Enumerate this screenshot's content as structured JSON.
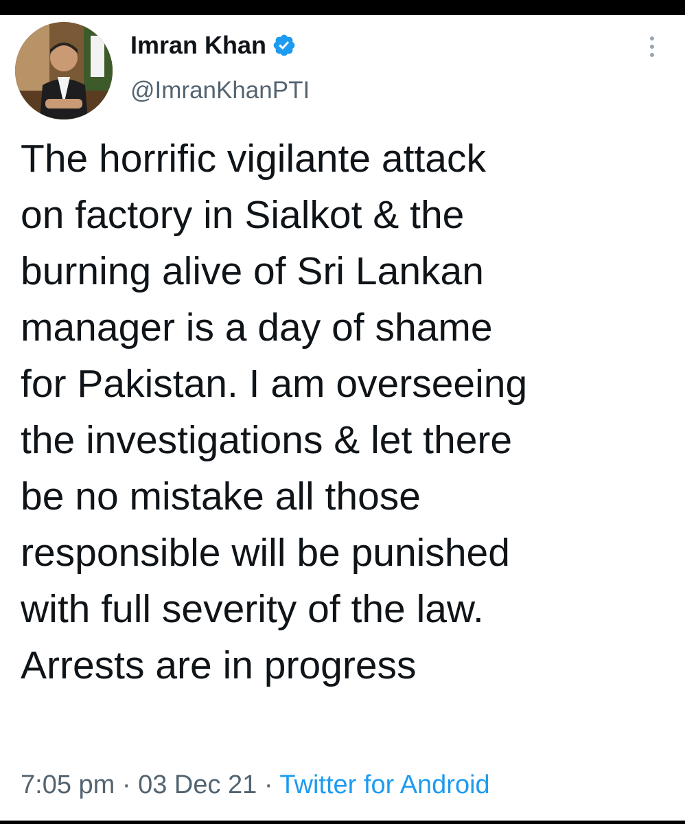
{
  "tweet": {
    "author": {
      "name": "Imran Khan",
      "handle": "@ImranKhanPTI",
      "verified": true,
      "avatar_icon": "profile-photo-icon"
    },
    "text_lines": [
      "The horrific vigilante attack",
      "on factory in Sialkot & the",
      "burning alive of Sri Lankan",
      "manager is a day of shame",
      "for Pakistan. I am overseeing",
      "the investigations & let there",
      "be no mistake all those",
      "responsible will be punished",
      "with full severity of the law.",
      "Arrests are in progress"
    ],
    "time": "7:05 pm",
    "separator": "·",
    "date": "03 Dec 21",
    "source": "Twitter for Android"
  },
  "colors": {
    "text": "#0f1419",
    "secondary": "#536471",
    "accent": "#1d9bf0",
    "verified_badge": "#1d9bf0"
  },
  "icons": {
    "verified": "verified-badge-icon",
    "more": "more-options-icon"
  }
}
